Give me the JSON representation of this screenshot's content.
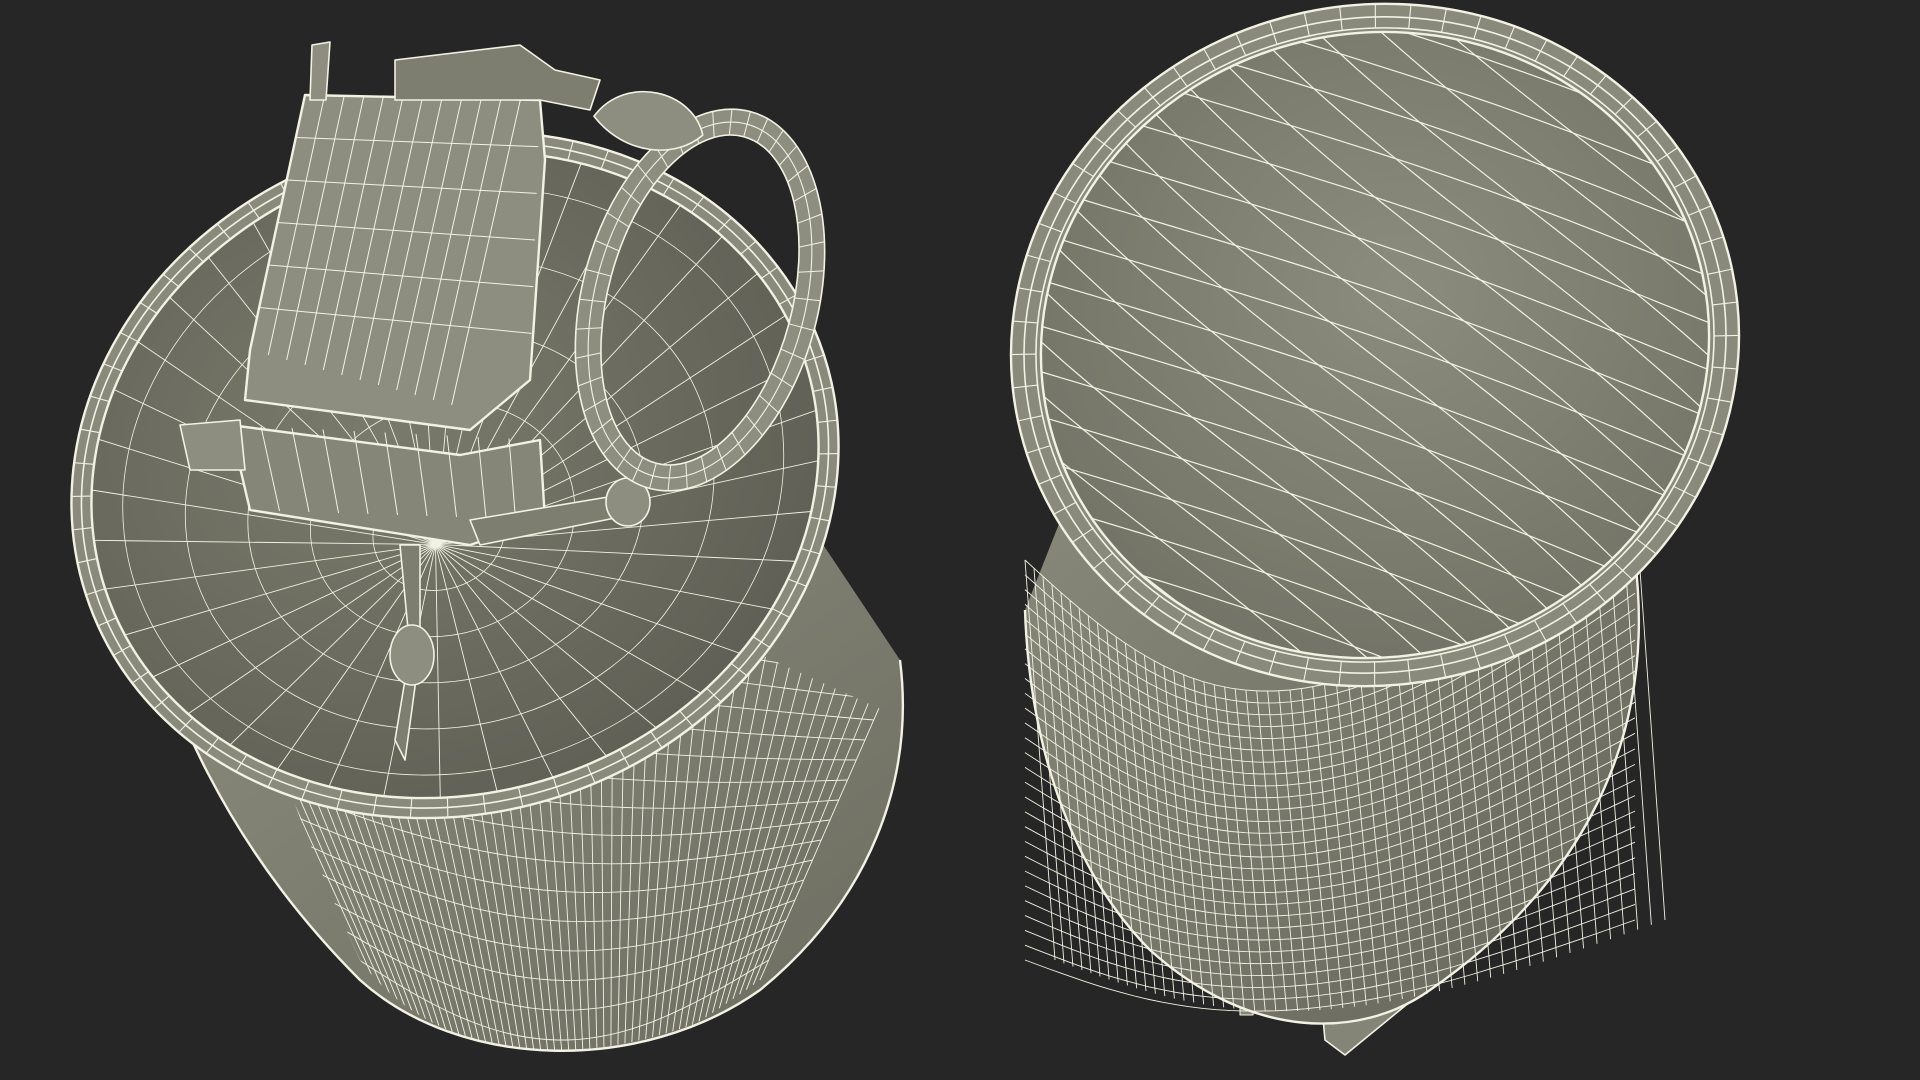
{
  "scene": {
    "background_color": "#262626",
    "surface_color": "#8a8a7c",
    "surface_shadow_color": "#5e5e54",
    "wire_color": "#f2f2e4"
  },
  "objects": [
    {
      "name": "grenade-top-view-wireframe",
      "icon": "grenade-icon"
    },
    {
      "name": "grenade-bottom-view-wireframe",
      "icon": "cylinder-icon"
    }
  ]
}
